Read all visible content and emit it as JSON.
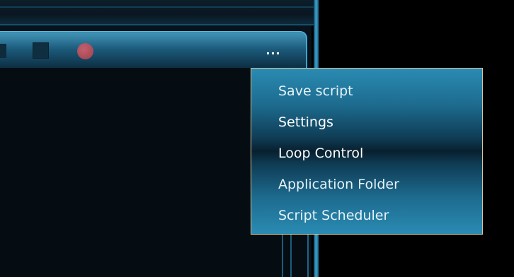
{
  "toolbar": {
    "more_label": "..."
  },
  "context_menu": {
    "items": [
      {
        "label": "Save script"
      },
      {
        "label": "Settings"
      },
      {
        "label": "Loop Control"
      },
      {
        "label": "Application Folder"
      },
      {
        "label": "Script Scheduler"
      }
    ]
  },
  "colors": {
    "background": "#000000",
    "toolbar_accent": "#2d89b0",
    "menu_border": "#d8c99a",
    "record_button": "#e0606a",
    "menu_text": "#ffffff"
  }
}
